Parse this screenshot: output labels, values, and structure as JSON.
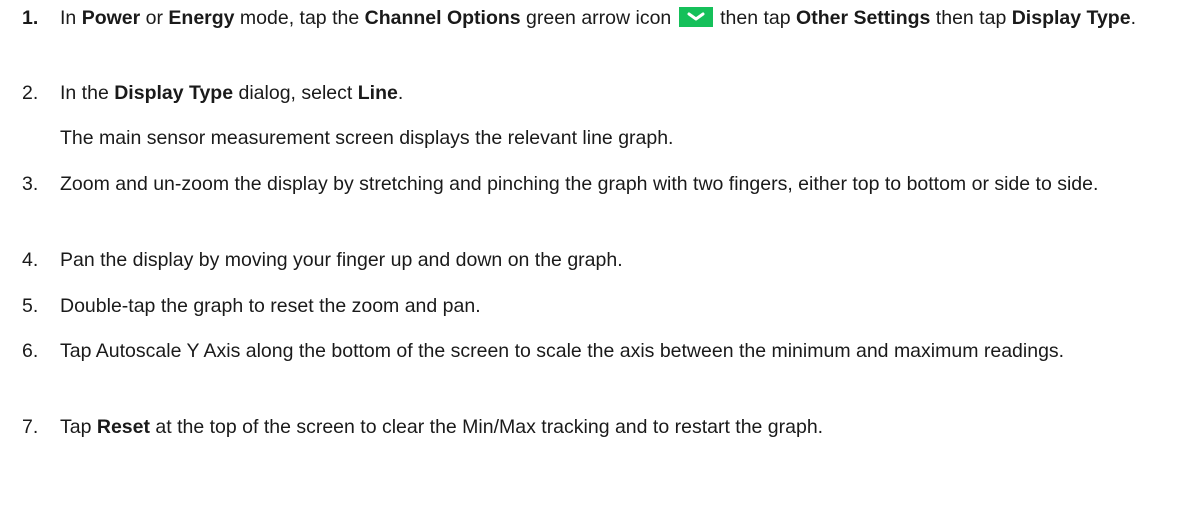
{
  "steps": [
    {
      "number": "1.",
      "t1": "In ",
      "b1": "Power",
      "t2": " or ",
      "b2": "Energy",
      "t3": " mode, tap the ",
      "b3": "Channel Options",
      "t4": " green arrow icon",
      "t5": " then tap ",
      "b4": "Other Settings",
      "t6": " then tap ",
      "b5": "Display Type",
      "t7": "."
    },
    {
      "number": "2.",
      "t1": "In the ",
      "b1": "Display Type",
      "t2": " dialog, select ",
      "b2": "Line",
      "t3": ".",
      "note": "The main sensor measurement screen displays the relevant line graph."
    },
    {
      "number": "3.",
      "text": "Zoom and un-zoom the display by stretching and pinching the graph with two fingers, either top to bottom or side to side."
    },
    {
      "number": "4.",
      "text": "Pan the display by moving your finger up and down on the graph."
    },
    {
      "number": "5.",
      "text": "Double-tap the graph to reset the zoom and pan."
    },
    {
      "number": "6.",
      "text": "Tap Autoscale Y Axis along the bottom of the screen to scale the axis between the minimum and maximum readings."
    },
    {
      "number": "7.",
      "t1": "Tap ",
      "b1": "Reset",
      "t2": " at the top of the screen to clear the Min/Max tracking and to restart the graph."
    }
  ],
  "icons": {
    "channel_options": "chevron-down-icon",
    "icon_color": "#15c05a"
  }
}
